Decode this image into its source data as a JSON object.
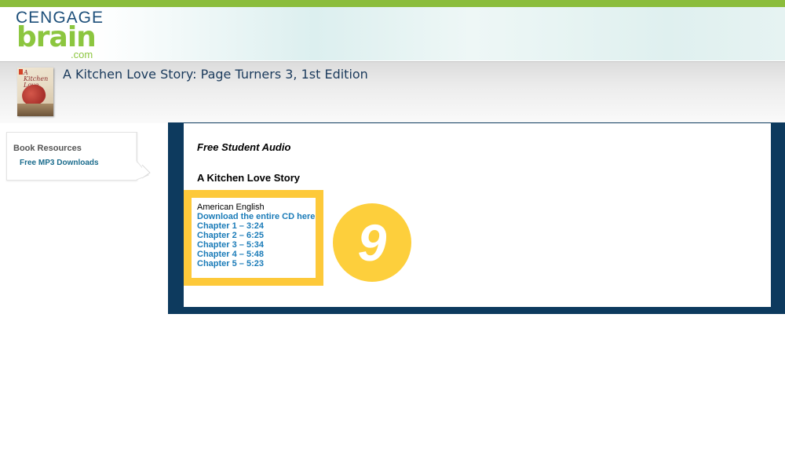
{
  "brand": {
    "logo_top": "CENGAGE",
    "logo_main": "brain",
    "logo_suffix": ".com"
  },
  "book": {
    "cover_text": "A Kitchen Love Story",
    "title": "A Kitchen Love Story: Page Turners 3, 1st Edition"
  },
  "sidebar": {
    "heading": "Book Resources",
    "link": "Free MP3 Downloads"
  },
  "main": {
    "section_heading": "Free Student Audio",
    "story_title": "A Kitchen Love Story",
    "audio": {
      "language": "American English",
      "download_all": "Download the entire CD here",
      "chapters": [
        "Chapter 1 – 3:24",
        "Chapter 2 – 6:25",
        "Chapter 3 – 5:34",
        "Chapter 4 – 5:48",
        "Chapter 5 – 5:23"
      ]
    }
  },
  "annotation": {
    "step_number": "9",
    "color": "#fdcf3c"
  },
  "colors": {
    "top_bar": "#8bbd3c",
    "frame": "#0d3a5e",
    "link": "#1a7bb8",
    "highlight": "#fdc93a"
  }
}
